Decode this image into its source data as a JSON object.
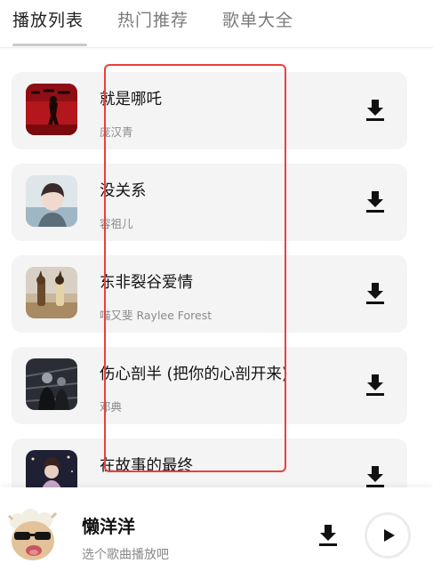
{
  "tabs": [
    {
      "label": "播放列表",
      "active": true
    },
    {
      "label": "热门推荐",
      "active": false
    },
    {
      "label": "歌单大全",
      "active": false
    }
  ],
  "songs": [
    {
      "title": "就是哪吒",
      "artist": "庞汉青",
      "cover_icon": "album-cover-red"
    },
    {
      "title": "没关系",
      "artist": "容祖儿",
      "cover_icon": "album-cover-portrait"
    },
    {
      "title": "东非裂谷爱情",
      "artist": "喵又斐 Raylee Forest",
      "cover_icon": "album-cover-desert"
    },
    {
      "title": "伤心剖半 (把你的心剖开来)",
      "artist": "邓典",
      "cover_icon": "album-cover-dark"
    },
    {
      "title": "在故事的最终",
      "artist": "",
      "cover_icon": "album-cover-night"
    }
  ],
  "icons": {
    "download": "download-icon",
    "play": "play-icon"
  },
  "player": {
    "title": "懒洋洋",
    "hint": "选个歌曲播放吧",
    "avatar_icon": "sheep-avatar"
  },
  "colors": {
    "highlight": "#e8413c",
    "card_bg": "#f4f4f4",
    "inactive_tab": "#7a7a7a"
  }
}
